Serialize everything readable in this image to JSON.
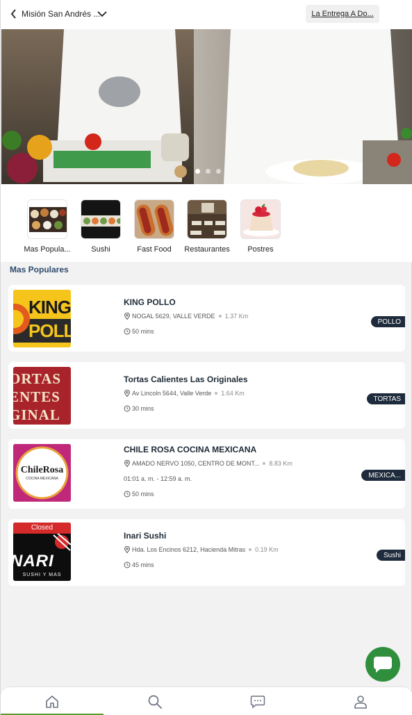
{
  "header": {
    "location": "Misión San Andrés ...",
    "delivery_mode": "La Entrega A Do..."
  },
  "banner": {
    "slides": 3,
    "active_slide": 1
  },
  "categories": [
    {
      "label": "Mas Popula..."
    },
    {
      "label": "Sushi"
    },
    {
      "label": "Fast Food"
    },
    {
      "label": "Restaurantes"
    },
    {
      "label": "Postres"
    }
  ],
  "section_title": "Mas Populares",
  "restaurants": [
    {
      "name": "KING POLLO",
      "address": "NOGAL 5629, VALLE VERDE",
      "distance": "1.37 Km",
      "time": "50 mins",
      "tag": "POLLO",
      "logo_text_top": "KING",
      "logo_text_bottom": "POLL"
    },
    {
      "name": "Tortas Calientes Las Originales",
      "address": "Av Lincoln 5644, Valle Verde",
      "distance": "1.64 Km",
      "time": "30 mins",
      "tag": "TORTAS",
      "logo_lines": [
        "ORTAS",
        "ENTES",
        "GINAL"
      ]
    },
    {
      "name": "CHILE ROSA COCINA MEXICANA",
      "address": "AMADO NERVO 1050, CENTRO DE MONT...",
      "distance": "8.83 Km",
      "hours": "01:01 a. m. - 12:59 a. m.",
      "time": "50 mins",
      "tag": "MEXICA...",
      "logo_text": "ChileRosa",
      "logo_sub": "COCINA MEXICANA"
    },
    {
      "name": "Inari Sushi",
      "address": "Hda. Los Encinos 6212, Hacienda Mitras",
      "distance": "0.19 Km",
      "time": "45 mins",
      "tag": "Sushi",
      "status": "Closed",
      "logo_text": "NARI",
      "logo_sub": "SUSHI Y MAS"
    }
  ],
  "nav": {
    "items": [
      "home-icon",
      "search-icon",
      "chat-icon",
      "profile-icon"
    ],
    "active": 0
  },
  "colors": {
    "accent": "#5a9d2e",
    "fab": "#2f8f3c",
    "tag_bg": "#1e2b3c",
    "section_title": "#2d4a6b",
    "closed": "#d42a2a"
  }
}
